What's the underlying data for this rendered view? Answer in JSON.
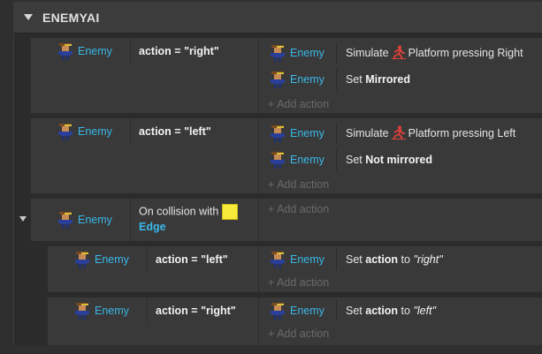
{
  "group": {
    "title": "ENEMYAI"
  },
  "object_name": "Enemy",
  "add_action": "+ Add action",
  "events": [
    {
      "condition": {
        "prefix": "action = ",
        "value": "\"right\""
      },
      "actions": [
        {
          "a": "Simulate",
          "b": "Platform pressing Right"
        },
        {
          "a": "Set",
          "b": "Mirrored"
        }
      ]
    },
    {
      "condition": {
        "prefix": "action = ",
        "value": "\"left\""
      },
      "actions": [
        {
          "a": "Simulate",
          "b": "Platform pressing Left"
        },
        {
          "a": "Set",
          "b": "Not mirrored"
        }
      ]
    },
    {
      "condition": {
        "prefix": "On collision with",
        "target": "Edge"
      }
    }
  ],
  "sub_events": [
    {
      "condition": {
        "prefix": "action = ",
        "value": "\"left\""
      },
      "action": {
        "a": "Set",
        "b": "action",
        "c": "to",
        "d": "\"right\""
      }
    },
    {
      "condition": {
        "prefix": "action = ",
        "value": "\"right\""
      },
      "action": {
        "a": "Set",
        "b": "action",
        "c": "to",
        "d": "\"left\""
      }
    }
  ],
  "colors": {
    "object": "#3ab7e8",
    "edge": "#f7ea3a",
    "platform_icon": "#e0413a",
    "trigger": "#3fc24a"
  }
}
